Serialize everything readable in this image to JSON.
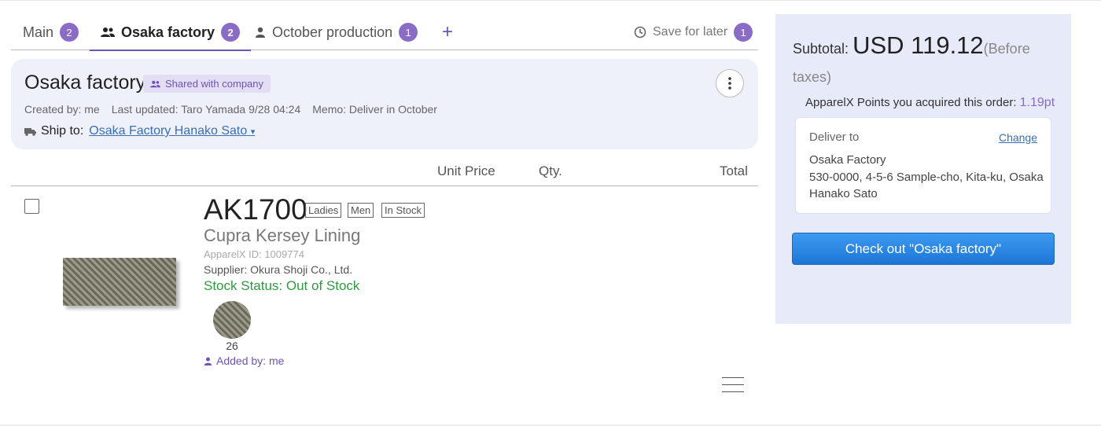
{
  "tabs": [
    {
      "label": "Main",
      "count": "2"
    },
    {
      "label": "Osaka factory",
      "count": "2",
      "icon": "group-icon"
    },
    {
      "label": "October production",
      "count": "1",
      "icon": "person-icon"
    }
  ],
  "add_tab_label": "+",
  "save_for_later": {
    "label": "Save for later",
    "count": "1",
    "icon": "clock-icon"
  },
  "list": {
    "title": "Osaka factory",
    "shared_label": "Shared with company",
    "created_by": "Created by: me",
    "last_updated": "Last updated: Taro Yamada 9/28 04:24",
    "memo": "Memo: Deliver in October",
    "ship_to_label": "Ship to:",
    "ship_to_value": "Osaka Factory Hanako Sato"
  },
  "columns": {
    "unit_price": "Unit Price",
    "qty": "Qty.",
    "total": "Total"
  },
  "item": {
    "sku": "AK1700",
    "tags": [
      "Ladies",
      "Men",
      "In Stock"
    ],
    "name": "Cupra Kersey Lining",
    "id": "ApparelX ID: 1009774",
    "supplier": "Supplier: Okura Shoji Co., Ltd.",
    "stock_status": "Stock Status: Out of Stock",
    "color_label": "26",
    "added_by": "Added by: me"
  },
  "summary": {
    "subtotal_label": "Subtotal:",
    "subtotal_amount": "USD 119.12",
    "subtotal_note": "(Before taxes)",
    "points_label": "ApparelX Points you acquired this order:",
    "points_value": "1.19pt",
    "deliver_to_label": "Deliver to",
    "change_label": "Change",
    "address_line1": "Osaka Factory",
    "address_line2": "530-0000, 4-5-6 Sample-cho, Kita-ku, Osaka",
    "address_line3": "Hanako Sato",
    "checkout_label": "Check out \"Osaka factory\""
  },
  "colors": {
    "accent": "#6f52b5",
    "badge": "#8a6cc6",
    "link": "#3a6fb5",
    "stock": "#2e9b3e",
    "checkout": "#1d76d6"
  }
}
